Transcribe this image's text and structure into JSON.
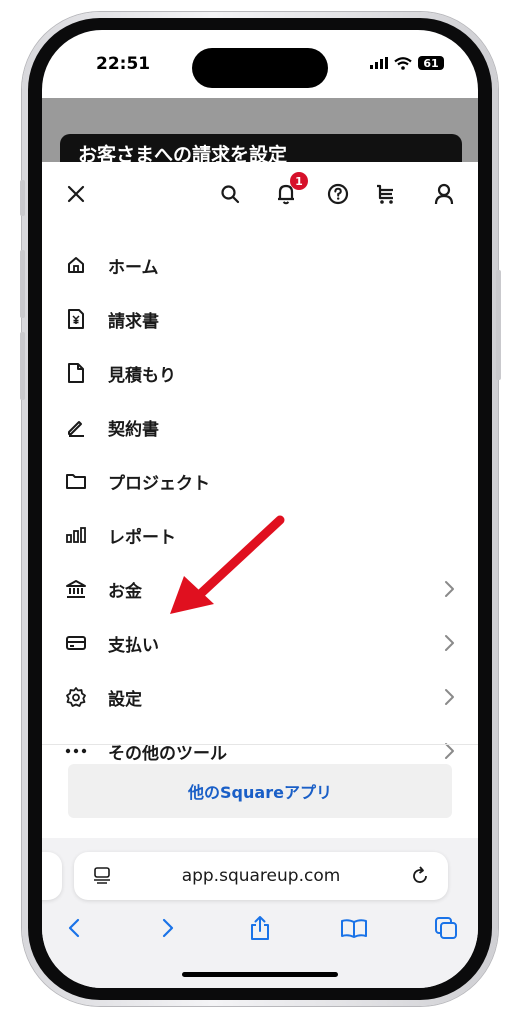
{
  "status_bar": {
    "time": "22:51",
    "battery": "61"
  },
  "background_page": {
    "card_title": "お客さまへの請求を設定"
  },
  "topbar": {
    "notification_count": "1",
    "icons": [
      "close-icon",
      "search-icon",
      "bell-icon",
      "help-icon",
      "cart-icon",
      "account-icon"
    ]
  },
  "menu": {
    "items": [
      {
        "label": "ホーム",
        "icon": "home-icon",
        "chevron": false
      },
      {
        "label": "請求書",
        "icon": "invoice-icon",
        "chevron": false
      },
      {
        "label": "見積もり",
        "icon": "document-icon",
        "chevron": false
      },
      {
        "label": "契約書",
        "icon": "pen-icon",
        "chevron": false
      },
      {
        "label": "プロジェクト",
        "icon": "folder-icon",
        "chevron": false
      },
      {
        "label": "レポート",
        "icon": "bar-chart-icon",
        "chevron": false
      },
      {
        "label": "お金",
        "icon": "bank-icon",
        "chevron": true
      },
      {
        "label": "支払い",
        "icon": "card-icon",
        "chevron": true
      },
      {
        "label": "設定",
        "icon": "gear-icon",
        "chevron": true
      },
      {
        "label": "その他のツール",
        "icon": "more-icon",
        "chevron": true
      }
    ]
  },
  "other_apps_button": "他のSquareアプリ",
  "browser": {
    "url": "app.squareup.com"
  },
  "colors": {
    "accent_blue": "#1a5fc7",
    "badge_red": "#d6102a",
    "arrow_red": "#e0101f"
  }
}
